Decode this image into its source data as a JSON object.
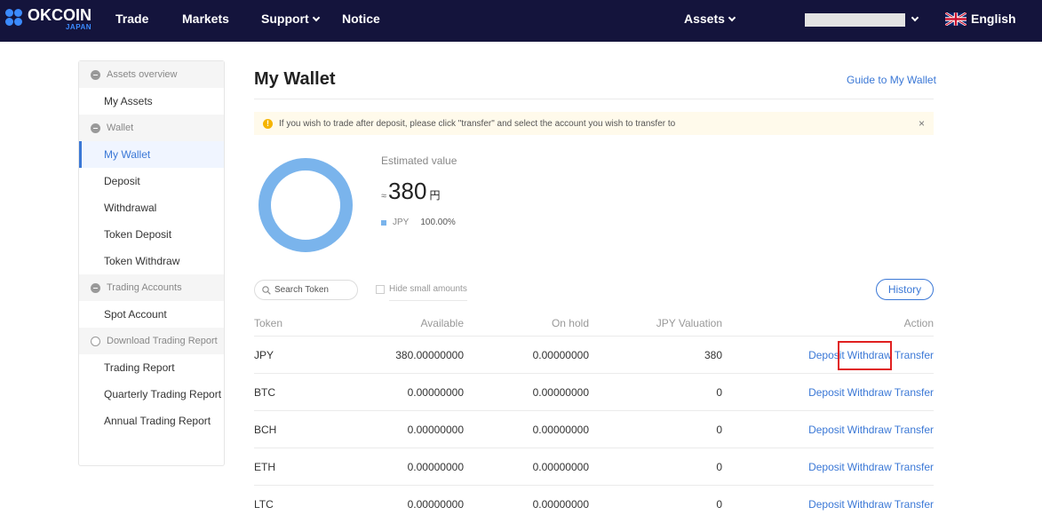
{
  "nav": {
    "logo_main": "OKCOIN",
    "logo_sub": "JAPAN",
    "items": [
      "Trade",
      "Markets",
      "Support",
      "Notice"
    ],
    "assets": "Assets",
    "language": "English",
    "colors": {
      "background": "#14143c",
      "logo_accent": "#3b8bff"
    }
  },
  "sidebar": {
    "groups": [
      {
        "label": "Assets overview",
        "items": [
          "My Assets"
        ]
      },
      {
        "label": "Wallet",
        "items": [
          "My Wallet",
          "Deposit",
          "Withdrawal",
          "Token Deposit",
          "Token Withdraw"
        ]
      },
      {
        "label": "Trading Accounts",
        "items": [
          "Spot Account"
        ]
      },
      {
        "label": "Download Trading Report",
        "items": [
          "Trading Report",
          "Quarterly Trading Report",
          "Annual Trading Report"
        ]
      }
    ],
    "active_item": "My Wallet"
  },
  "main": {
    "title": "My Wallet",
    "guide_link": "Guide to My Wallet",
    "notice": "If you wish to trade after deposit, please click \"transfer\" and select the account you wish to transfer to",
    "notice_close": "×",
    "estimated_label": "Estimated value",
    "estimated_approx": "≈",
    "estimated_value": "380",
    "estimated_unit": "円",
    "legend_currency": "JPY",
    "legend_pct": "100.00%",
    "search_placeholder": "Search Token",
    "hide_small": "Hide small amounts",
    "history": "History",
    "columns": {
      "token": "Token",
      "available": "Available",
      "on_hold": "On hold",
      "valuation": "JPY Valuation",
      "action": "Action"
    },
    "actions": {
      "deposit": "Deposit",
      "withdraw": "Withdraw",
      "transfer": "Transfer"
    },
    "rows": [
      {
        "token": "JPY",
        "available": "380.00000000",
        "on_hold": "0.00000000",
        "valuation": "380"
      },
      {
        "token": "BTC",
        "available": "0.00000000",
        "on_hold": "0.00000000",
        "valuation": "0"
      },
      {
        "token": "BCH",
        "available": "0.00000000",
        "on_hold": "0.00000000",
        "valuation": "0"
      },
      {
        "token": "ETH",
        "available": "0.00000000",
        "on_hold": "0.00000000",
        "valuation": "0"
      },
      {
        "token": "LTC",
        "available": "0.00000000",
        "on_hold": "0.00000000",
        "valuation": "0"
      }
    ],
    "colors": {
      "link": "#3b78d6",
      "donut": "#7ab4ec",
      "notice_bg": "#fffaeb",
      "highlight": "#e02020"
    }
  }
}
